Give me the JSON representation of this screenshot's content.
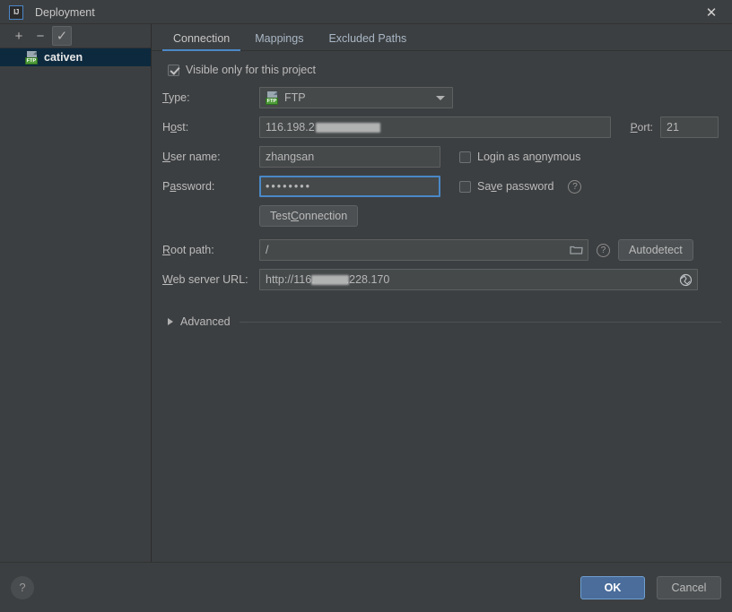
{
  "window": {
    "title": "Deployment",
    "logo_text": "IJ",
    "close_label": "✕"
  },
  "left_panel": {
    "toolbar": {
      "add_label": "+",
      "remove_label": "−",
      "toggle_label": "✓"
    },
    "servers": [
      {
        "name": "cativen",
        "icon": "ftp-server-icon",
        "badge": "FTP",
        "selected": true
      }
    ]
  },
  "tabs": [
    {
      "label": "Connection",
      "active": true
    },
    {
      "label": "Mappings",
      "active": false
    },
    {
      "label": "Excluded Paths",
      "active": false
    }
  ],
  "connection": {
    "visible_only_checkbox": {
      "label": "Visible only for this project",
      "checked": true
    },
    "type": {
      "label_pre": "",
      "label_mnemonic": "T",
      "label_post": "ype:",
      "value": "FTP",
      "icon_badge": "FTP"
    },
    "host": {
      "label_pre": "H",
      "label_mnemonic": "o",
      "label_post": "st:",
      "value": "116.198.2",
      "redacted": true
    },
    "port": {
      "label_mnemonic": "P",
      "label_post": "ort:",
      "value": "21"
    },
    "username": {
      "label_mnemonic": "U",
      "label_post": "ser name:",
      "value": "zhangsan"
    },
    "password": {
      "label_pre": "P",
      "label_mnemonic": "a",
      "label_post": "ssword:",
      "value": "••••••••",
      "focused": true
    },
    "login_anonymous": {
      "label_pre": "Login as an",
      "label_mnemonic": "o",
      "label_post": "nymous",
      "checked": false
    },
    "save_password": {
      "label_pre": "Sa",
      "label_mnemonic": "v",
      "label_post": "e password",
      "checked": false
    },
    "save_password_help": "?",
    "test_connection": {
      "label_pre": "Test ",
      "label_mnemonic": "C",
      "label_post": "onnection"
    },
    "root_path": {
      "label_mnemonic": "R",
      "label_post": "oot path:",
      "value": "/",
      "browse_icon": "folder-icon"
    },
    "root_path_help": "?",
    "autodetect_label": "Autodetect",
    "web_server_url": {
      "label_mnemonic": "W",
      "label_post": "eb server URL:",
      "value_pre": "http://116.",
      "value_post": ".228.170",
      "redacted": true,
      "open_icon": "globe-icon"
    },
    "advanced": {
      "label": "Advanced",
      "expanded": false
    }
  },
  "footer": {
    "help_label": "?",
    "ok_label": "OK",
    "cancel_label": "Cancel"
  },
  "colors": {
    "accent": "#4a88c7",
    "ok_button": "#4a6d9b",
    "selection": "#0d293e",
    "background": "#3c3f41",
    "field": "#45494a"
  }
}
